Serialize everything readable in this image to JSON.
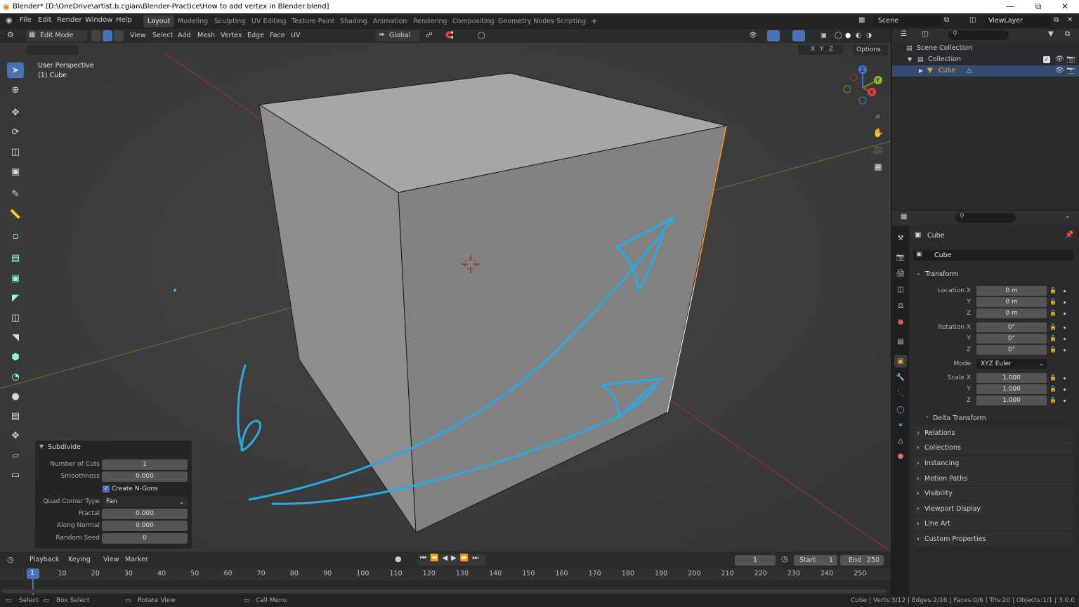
{
  "window": {
    "title": "Blender* [D:\\OneDrive\\artist.b.cgian\\Blender-Practice\\How to add vertex in Blender.blend]",
    "minimize": "—",
    "maximize": "⧉",
    "close": "✕"
  },
  "menu": [
    "File",
    "Edit",
    "Render",
    "Window",
    "Help"
  ],
  "workspaces": [
    "Layout",
    "Modeling",
    "Sculpting",
    "UV Editing",
    "Texture Paint",
    "Shading",
    "Animation",
    "Rendering",
    "Compositing",
    "Geometry Nodes",
    "Scripting"
  ],
  "add_workspace": "+",
  "scene": {
    "name": "Scene",
    "view_layer": "ViewLayer"
  },
  "viewport_header": {
    "mode": "Edit Mode",
    "menus": [
      "View",
      "Select",
      "Add",
      "Mesh",
      "Vertex",
      "Edge",
      "Face",
      "UV"
    ],
    "orientation": "Global",
    "axes": [
      "X",
      "Y",
      "Z"
    ],
    "options": "Options"
  },
  "viewport": {
    "perspective": "User Perspective",
    "object": "(1) Cube",
    "gizmo": {
      "z": "Z",
      "y": "Y",
      "x": "X"
    },
    "colors": {
      "accent": "#4772b3",
      "annotation": "#29a9e6",
      "x_axis": "#c04040",
      "y_axis": "#6a8a2a",
      "edge_selected": "#ff9a2a"
    }
  },
  "redo_panel": {
    "title": "Subdivide",
    "fields": [
      {
        "label": "Number of Cuts",
        "value": "1"
      },
      {
        "label": "Smoothness",
        "value": "0.000"
      },
      {
        "label": "Quad Corner Type",
        "value": "Fan"
      },
      {
        "label": "Fractal",
        "value": "0.000"
      },
      {
        "label": "Along Normal",
        "value": "0.000"
      },
      {
        "label": "Random Seed",
        "value": "0"
      }
    ],
    "checkbox": {
      "label": "Create N-Gons",
      "checked": true
    }
  },
  "timeline": {
    "menus": [
      "Playback",
      "Keying",
      "View",
      "Marker"
    ],
    "current_frame": "1",
    "start_label": "Start",
    "start": "1",
    "end_label": "End",
    "end": "250",
    "ticks": [
      "1",
      "10",
      "20",
      "30",
      "40",
      "50",
      "60",
      "70",
      "80",
      "90",
      "100",
      "110",
      "120",
      "130",
      "140",
      "150",
      "160",
      "170",
      "180",
      "190",
      "200",
      "210",
      "220",
      "230",
      "240",
      "250"
    ]
  },
  "statusbar": {
    "select": "Select",
    "box_select": "Box Select",
    "rotate_view": "Rotate View",
    "call_menu": "Call Menu",
    "stats": "Cube | Verts:3/12 | Edges:2/16 | Faces:0/6 | Tris:20 | Objects:1/1 | 3.0.0"
  },
  "outliner": {
    "scene_collection": "Scene Collection",
    "collection": "Collection",
    "cube": "Cube"
  },
  "properties": {
    "object_name": "Cube",
    "data_name": "Cube",
    "transform": {
      "title": "Transform",
      "location": [
        {
          "label": "Location X",
          "value": "0 m"
        },
        {
          "label": "Y",
          "value": "0 m"
        },
        {
          "label": "Z",
          "value": "0 m"
        }
      ],
      "rotation": [
        {
          "label": "Rotation X",
          "value": "0°"
        },
        {
          "label": "Y",
          "value": "0°"
        },
        {
          "label": "Z",
          "value": "0°"
        }
      ],
      "mode_label": "Mode",
      "mode": "XYZ Euler",
      "scale": [
        {
          "label": "Scale X",
          "value": "1.000"
        },
        {
          "label": "Y",
          "value": "1.000"
        },
        {
          "label": "Z",
          "value": "1.000"
        }
      ],
      "delta": "Delta Transform"
    },
    "panels": [
      "Relations",
      "Collections",
      "Instancing",
      "Motion Paths",
      "Visibility",
      "Viewport Display",
      "Line Art",
      "Custom Properties"
    ]
  }
}
